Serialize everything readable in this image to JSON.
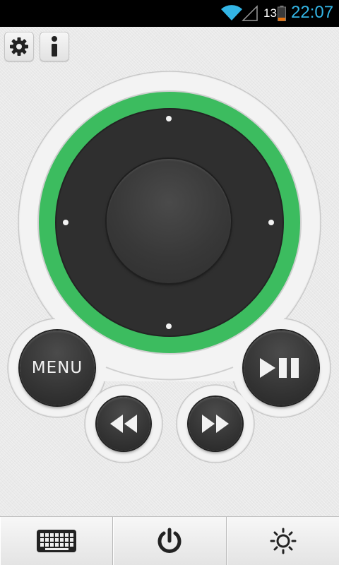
{
  "status_bar": {
    "battery_level": "13",
    "time": "22:07",
    "icons": [
      "wifi-icon",
      "signal-icon",
      "battery-icon"
    ]
  },
  "top_buttons": [
    {
      "icon": "gear-icon"
    },
    {
      "icon": "info-icon"
    }
  ],
  "remote": {
    "ring_color": "#3cbc5f",
    "pad_color": "#2f2f2f",
    "menu_label": "MENU"
  },
  "bottom_bar": {
    "icons": [
      "keyboard-icon",
      "power-icon",
      "brightness-icon"
    ]
  }
}
